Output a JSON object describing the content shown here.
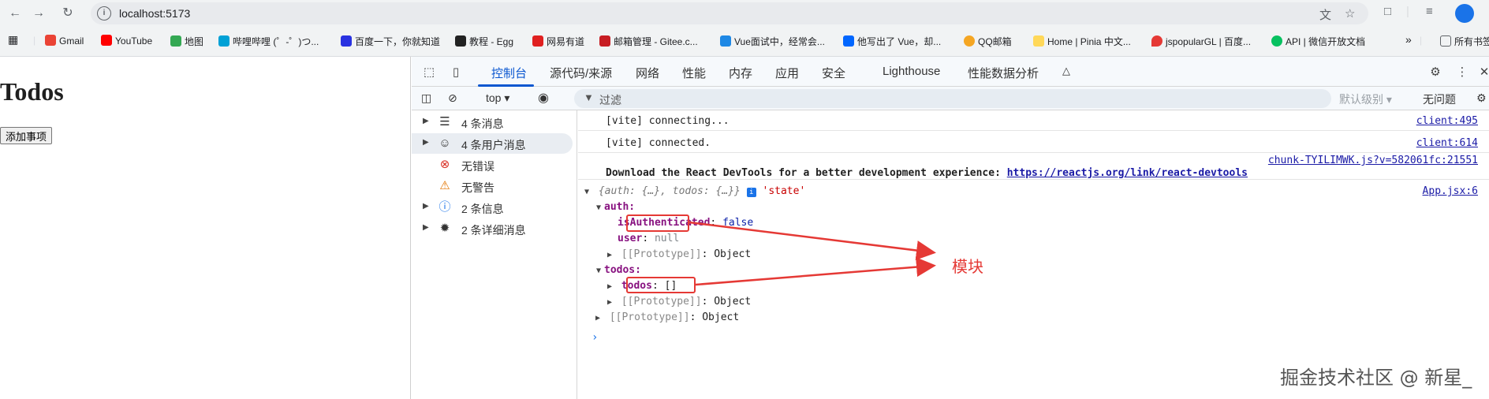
{
  "browser": {
    "url": "localhost:5173",
    "back_icon": "arrow-left",
    "forward_icon": "arrow-right",
    "reload_icon": "reload"
  },
  "bookmarks": [
    {
      "label": "Gmail",
      "color": "#ea4335"
    },
    {
      "label": "YouTube",
      "color": "#ff0000"
    },
    {
      "label": "地图",
      "color": "#34a853"
    },
    {
      "label": "哔哩哔哩 (゜-゜)つ...",
      "color": "#00a1d6"
    },
    {
      "label": "百度一下，你就知道",
      "color": "#2932e1"
    },
    {
      "label": "教程 - Egg",
      "color": "#222222"
    },
    {
      "label": "网易有道",
      "color": "#e02020"
    },
    {
      "label": "邮箱管理 - Gitee.c...",
      "color": "#c71d23"
    },
    {
      "label": "Vue面试中，经常会...",
      "color": "#1e88e5"
    },
    {
      "label": "他写出了 Vue，却...",
      "color": "#0066ff"
    },
    {
      "label": "QQ邮箱",
      "color": "#f5a623"
    },
    {
      "label": "Home | Pinia 中文...",
      "color": "#ffd859"
    },
    {
      "label": "jspopularGL | 百度...",
      "color": "#e53935"
    },
    {
      "label": "API | 微信开放文档",
      "color": "#07c160"
    },
    {
      "label": "所有书签",
      "color": "#5f6368"
    }
  ],
  "app": {
    "title": "Todos",
    "add_button": "添加事项"
  },
  "devtools": {
    "tabs": [
      "控制台",
      "源代码/来源",
      "网络",
      "性能",
      "内存",
      "应用",
      "安全",
      "Lighthouse",
      "性能数据分析"
    ],
    "active_tab": "控制台",
    "toolbar": {
      "context": "top",
      "filter_placeholder": "过滤",
      "levels": "默认级别",
      "issues": "无问题"
    },
    "sidebar": [
      {
        "label": "4 条消息",
        "icon": "list-icon"
      },
      {
        "label": "4 条用户消息",
        "icon": "user-icon"
      },
      {
        "label": "无错误",
        "icon": "error-icon"
      },
      {
        "label": "无警告",
        "icon": "warning-icon"
      },
      {
        "label": "2 条信息",
        "icon": "info-icon"
      },
      {
        "label": "2 条详细消息",
        "icon": "bug-icon"
      }
    ],
    "console": {
      "line1": "[vite] connecting...",
      "line1_src": "client:495",
      "line2": "[vite] connected.",
      "line2_src": "client:614",
      "line3_src": "chunk-TYILIMWK.js?v=582061fc:21551",
      "line3_text": "Download the React DevTools for a better development experience: ",
      "line3_link": "https://reactjs.org/link/react-devtools",
      "obj_summary_a": "{auth: {…}, todos: {…}}",
      "obj_label": "'state'",
      "obj_src": "App.jsx:6",
      "auth_key": "auth:",
      "isAuth_key": "isAuthenticated",
      "isAuth_val": "false",
      "user_key": "user",
      "user_val": "null",
      "proto_key": "[[Prototype]]",
      "proto_val": "Object",
      "todos_key": "todos:",
      "todos_inner_key": "todos",
      "todos_inner_val": "[]"
    },
    "annotation": "模块"
  },
  "watermark": "掘金技术社区 @ 新星_"
}
